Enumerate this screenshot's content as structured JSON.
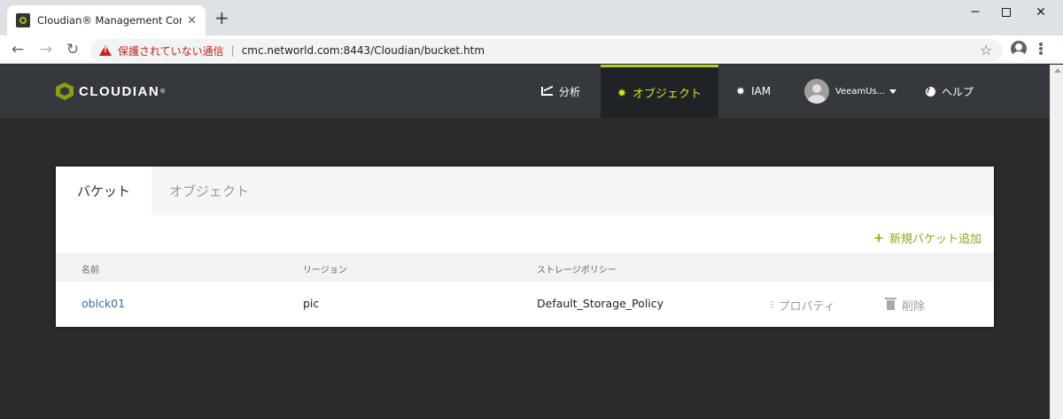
{
  "browser": {
    "tab_title": "Cloudian® Management Console",
    "tab_close": "✕",
    "new_tab": "+",
    "security_label": "保護されていない通信",
    "url": "cmc.networld.com:8443/Cloudian/bucket.htm"
  },
  "app": {
    "logo_text": "CLOUDIAN",
    "logo_tm": "®",
    "nav": {
      "analysis": "分析",
      "object": "オブジェクト",
      "iam": "IAM",
      "user": "VeeamUs...",
      "help": "ヘルプ"
    }
  },
  "card": {
    "tabs": [
      "バケット",
      "オブジェクト"
    ],
    "add_bucket": "新規バケット追加",
    "columns": [
      "名前",
      "リージョン",
      "ストレージポリシー"
    ],
    "rows": [
      {
        "name": "oblck01",
        "region": "pic",
        "policy": "Default_Storage_Policy",
        "properties": "プロパティ",
        "delete": "削除"
      }
    ]
  },
  "colors": {
    "accent": "#b8cc1d",
    "header_bg": "#35393d",
    "link": "#2f6fa8",
    "warning": "#c5221f"
  }
}
